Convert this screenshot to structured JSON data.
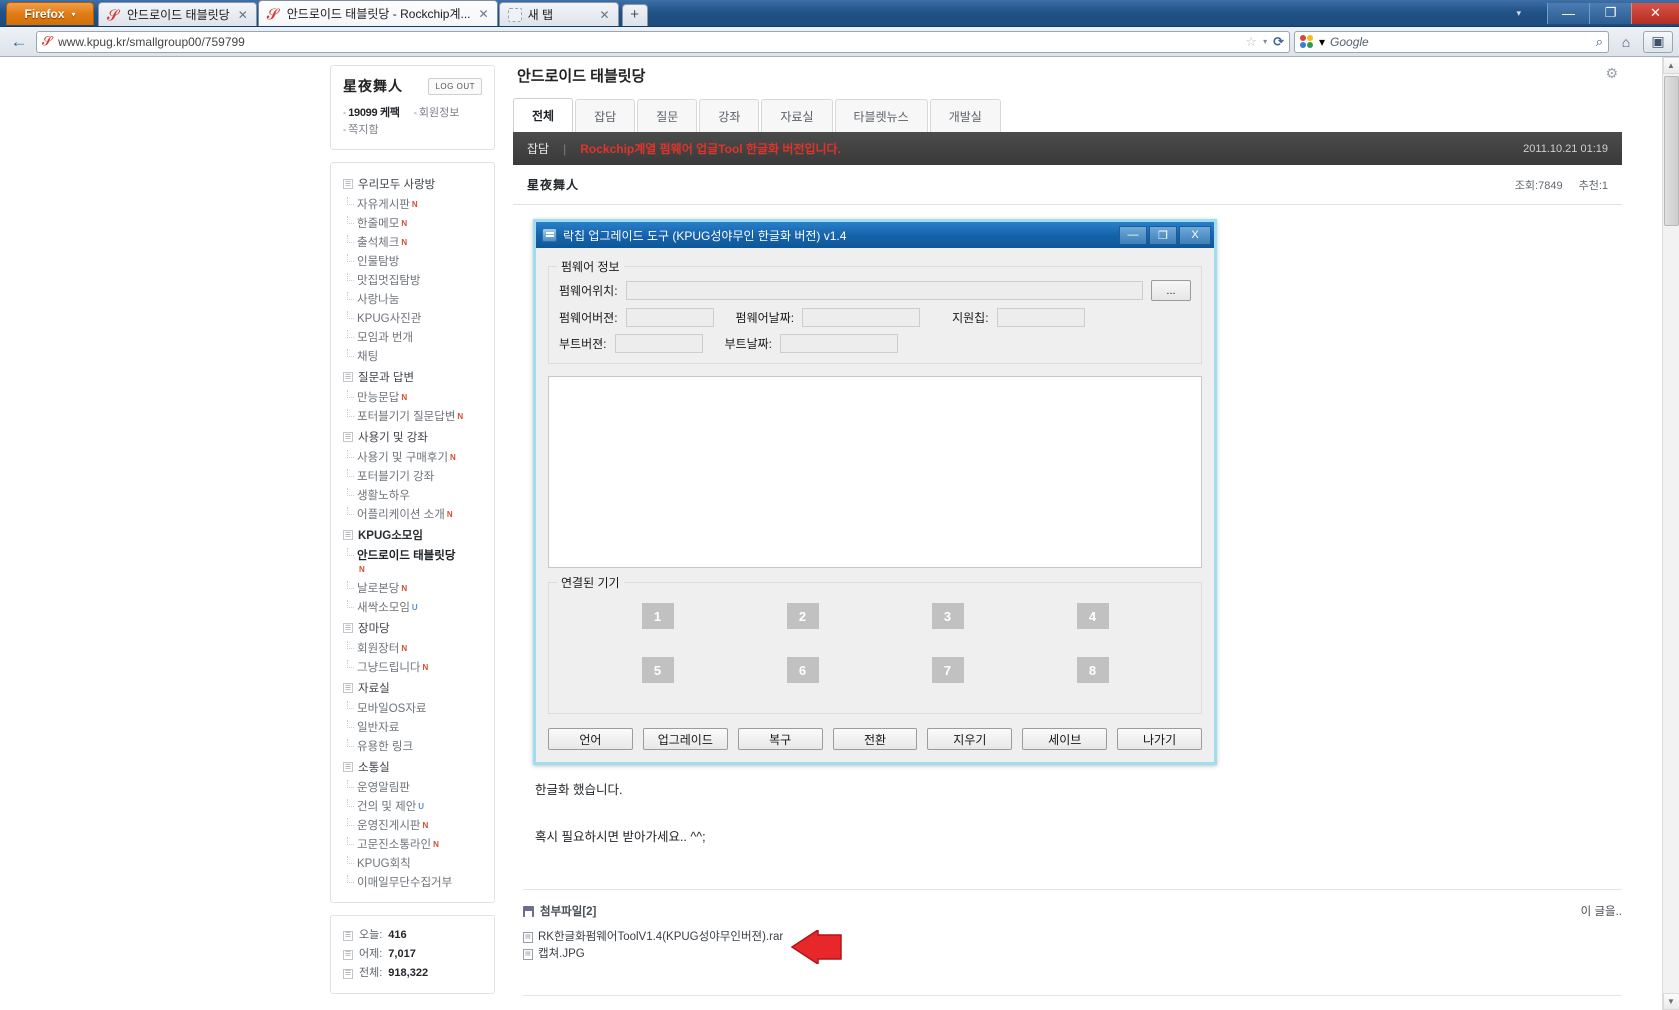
{
  "browser": {
    "app_button": "Firefox",
    "tabs": [
      {
        "title": "안드로이드 태블릿당",
        "favicon": "kpug-icon",
        "active": false
      },
      {
        "title": "안드로이드 태블릿당 - Rockchip계...",
        "favicon": "kpug-icon",
        "active": true
      },
      {
        "title": "새 탭",
        "favicon": "blank-icon",
        "active": false
      }
    ],
    "new_tab_label": "+",
    "window_controls": {
      "list_all": "▾",
      "minimize": "—",
      "restore": "❐",
      "close": "✕"
    },
    "nav": {
      "back": "←",
      "forward": "→"
    },
    "url": "www.kpug.kr/smallgroup00/759799",
    "url_domain": "www.kpug.kr",
    "url_path": "/smallgroup00/759799",
    "star": "☆",
    "dropdown": "▾",
    "reload": "⟳",
    "search_engine": "Google",
    "search_magnifier": "⌕",
    "home": "⌂",
    "bookmarks": "▣"
  },
  "sidebar": {
    "user": {
      "name": "星夜舞人",
      "logout_label": "LOG OUT",
      "points": "19099 케팩",
      "member_info": "회원정보",
      "messages": "쪽지함"
    },
    "groups": [
      {
        "label": "우리모두 사랑방",
        "bold": false,
        "items": [
          {
            "label": "자유게시판",
            "badge": "N"
          },
          {
            "label": "한줄메모",
            "badge": "N"
          },
          {
            "label": "출석체크",
            "badge": "N"
          },
          {
            "label": "인물탐방",
            "badge": ""
          },
          {
            "label": "맛집멋집탐방",
            "badge": ""
          },
          {
            "label": "사랑나눔",
            "badge": ""
          },
          {
            "label": "KPUG사진관",
            "badge": ""
          },
          {
            "label": "모임과 번개",
            "badge": ""
          },
          {
            "label": "채팅",
            "badge": ""
          }
        ]
      },
      {
        "label": "질문과 답변",
        "bold": false,
        "items": [
          {
            "label": "만능문답",
            "badge": "N"
          },
          {
            "label": "포터블기기 질문답변",
            "badge": "N"
          }
        ]
      },
      {
        "label": "사용기 및 강좌",
        "bold": false,
        "items": [
          {
            "label": "사용기 및 구매후기",
            "badge": "N"
          },
          {
            "label": "포터블기기 강좌",
            "badge": ""
          },
          {
            "label": "생활노하우",
            "badge": ""
          },
          {
            "label": "어플리케이션 소개",
            "badge": "N"
          }
        ]
      },
      {
        "label": "KPUG소모임",
        "bold": true,
        "items": [
          {
            "label": "안드로이드 태블릿당",
            "badge": "N",
            "current": true
          },
          {
            "label": "날로본당",
            "badge": "N"
          },
          {
            "label": "새싹소모임",
            "badge": "U"
          }
        ]
      },
      {
        "label": "장마당",
        "bold": false,
        "items": [
          {
            "label": "회원장터",
            "badge": "N"
          },
          {
            "label": "그냥드립니다",
            "badge": "N"
          }
        ]
      },
      {
        "label": "자료실",
        "bold": false,
        "items": [
          {
            "label": "모바일OS자료",
            "badge": ""
          },
          {
            "label": "일반자료",
            "badge": ""
          },
          {
            "label": "유용한 링크",
            "badge": ""
          }
        ]
      },
      {
        "label": "소통실",
        "bold": false,
        "items": [
          {
            "label": "운영알림판",
            "badge": ""
          },
          {
            "label": "건의 및 제안",
            "badge": "U"
          },
          {
            "label": "운영진게시판",
            "badge": "N"
          },
          {
            "label": "고문진소통라인",
            "badge": "N"
          },
          {
            "label": "KPUG회칙",
            "badge": ""
          },
          {
            "label": "이매일무단수집거부",
            "badge": ""
          }
        ]
      }
    ],
    "stats": [
      {
        "label": "오늘:",
        "value": "416"
      },
      {
        "label": "어제:",
        "value": "7,017"
      },
      {
        "label": "전체:",
        "value": "918,322"
      }
    ]
  },
  "main": {
    "board_title": "안드로이드 태블릿당",
    "gear_icon": "⚙",
    "tabs": [
      {
        "label": "전체",
        "active": true
      },
      {
        "label": "잡담",
        "active": false
      },
      {
        "label": "질문",
        "active": false
      },
      {
        "label": "강좌",
        "active": false
      },
      {
        "label": "자료실",
        "active": false
      },
      {
        "label": "타블렛뉴스",
        "active": false
      },
      {
        "label": "개발실",
        "active": false
      }
    ],
    "post": {
      "category": "잡담",
      "separator": "|",
      "title": "Rockchip계열 펌웨어 업글Tool 한글화 버전입니다.",
      "date": "2011.10.21 01:19",
      "author": "星夜舞人",
      "views": "조회:7849",
      "recommends": "추천:1",
      "paragraphs": [
        "한글화 했습니다.",
        "혹시 필요하시면 받아가세요.. ^^;"
      ]
    },
    "attachments": {
      "header": "첨부파일[2]",
      "right_link": "이 글을..",
      "files": [
        "RK한글화펌웨어ToolV1.4(KPUG성야무인버젼).rar",
        "캡쳐.JPG"
      ]
    }
  },
  "dialog": {
    "title": "락칩 업그레이드 도구 (KPUG성야무인 한글화 버전) v1.4",
    "icon": "app-icon",
    "controls": {
      "minimize": "—",
      "maximize": "❐",
      "close": "X"
    },
    "firmware_group": "펌웨어 정보",
    "fields": {
      "path_label": "펌웨어위치:",
      "path_value": "",
      "browse_label": "...",
      "fw_version_label": "펌웨어버젼:",
      "fw_version_value": "",
      "fw_date_label": "펌웨어날짜:",
      "fw_date_value": "",
      "chip_label": "지원칩:",
      "chip_value": "",
      "boot_version_label": "부트버젼:",
      "boot_version_value": "",
      "boot_date_label": "부트날짜:",
      "boot_date_value": ""
    },
    "log_value": "",
    "devices_group": "연결된 기기",
    "devices": [
      "1",
      "2",
      "3",
      "4",
      "5",
      "6",
      "7",
      "8"
    ],
    "buttons": [
      "언어",
      "업그레이드",
      "복구",
      "전환",
      "지우기",
      "세이브",
      "나가기"
    ]
  }
}
